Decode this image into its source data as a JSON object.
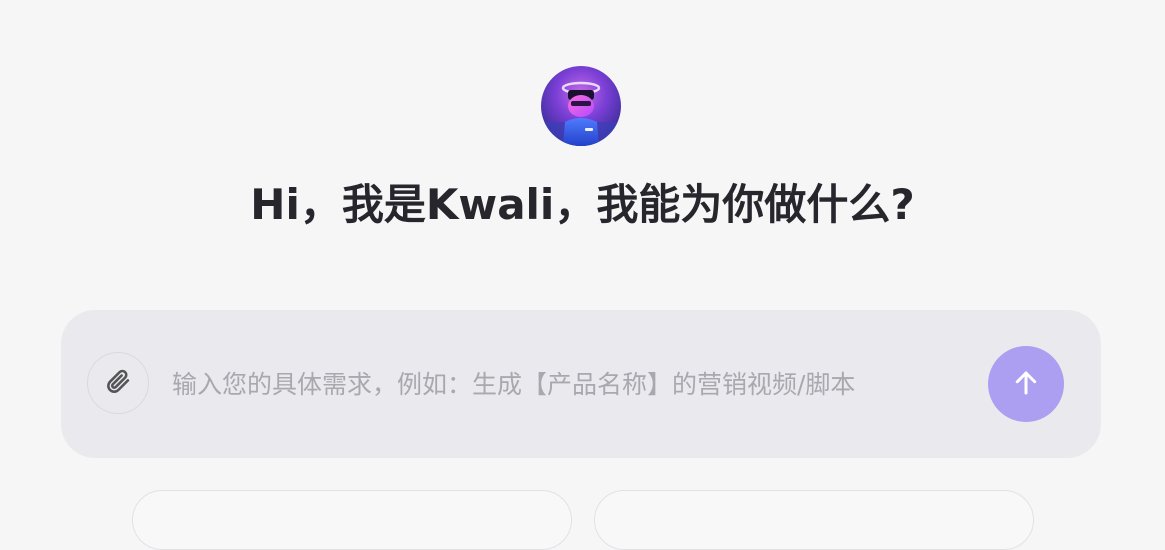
{
  "greeting": {
    "headline": "Hi，我是Kwali，我能为你做什么?"
  },
  "composer": {
    "placeholder": "输入您的具体需求，例如：生成【产品名称】的营销视频/脚本",
    "value": ""
  },
  "icons": {
    "attach": "paperclip-icon",
    "send": "arrow-up-icon",
    "avatar": "kwali-avatar"
  },
  "colors": {
    "background": "#f6f6f7",
    "composer_bg": "#eaeaee",
    "send_button": "#ac9ef0",
    "headline_text": "#26262c",
    "placeholder_text": "#a8a8ae"
  }
}
